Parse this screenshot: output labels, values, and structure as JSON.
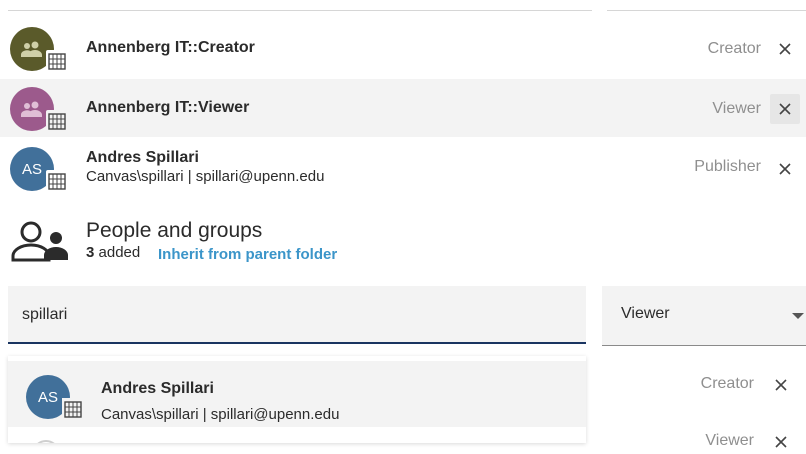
{
  "colors": {
    "accent_blue": "#3b95c9",
    "focus_underline": "#1a3561",
    "avatar_creator_group": "#5a5a2a",
    "avatar_viewer_group": "#9c5a8c",
    "avatar_user": "#41709a"
  },
  "members": [
    {
      "name": "Annenberg IT::Creator",
      "role": "Creator",
      "remove_icon": "close-icon",
      "avatar_icon": "group-icon",
      "badge_icon": "building-icon"
    },
    {
      "name": "Annenberg IT::Viewer",
      "role": "Viewer",
      "remove_icon": "close-icon",
      "avatar_icon": "group-icon",
      "badge_icon": "building-icon"
    },
    {
      "name": "Andres Spillari",
      "initials": "AS",
      "subtitle": "Canvas\\spillari | spillari@upenn.edu",
      "role": "Publisher",
      "remove_icon": "close-icon",
      "badge_icon": "building-icon"
    }
  ],
  "people_section": {
    "title": "People and groups",
    "count": "3",
    "count_suffix": " added",
    "inherit_link": "Inherit from parent folder",
    "icon": "people-icon"
  },
  "search": {
    "value": "spillari",
    "role_selected": "Viewer",
    "role_arrow_icon": "caret-down-icon"
  },
  "suggestions": [
    {
      "name": "Andres Spillari",
      "initials": "AS",
      "subtitle": "Canvas\\spillari | spillari@upenn.edu",
      "badge_icon": "building-icon"
    }
  ],
  "background_rows": [
    {
      "role": "Creator"
    },
    {
      "role": "Viewer"
    }
  ]
}
